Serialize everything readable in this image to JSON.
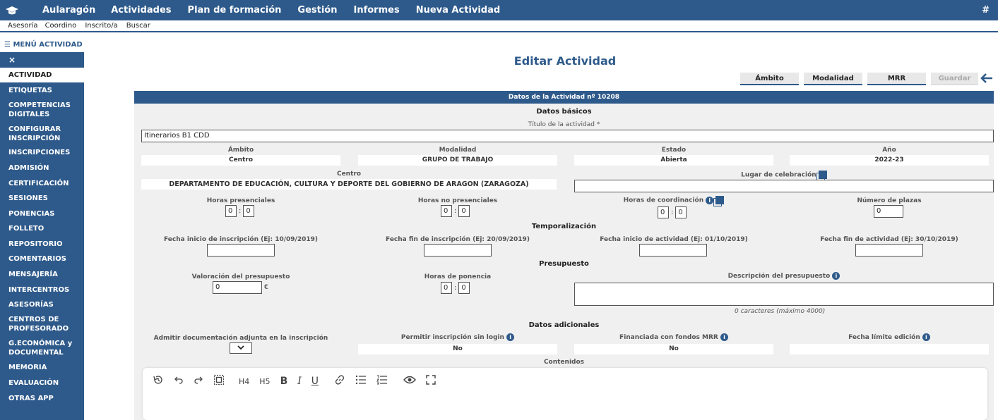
{
  "nav": {
    "brand": "Aularagón",
    "items": [
      "Actividades",
      "Plan de formación",
      "Gestión",
      "Informes",
      "Nueva Actividad"
    ],
    "hash": "#"
  },
  "submenu": [
    "Asesoría",
    "Coordino",
    "Inscrito/a",
    "Buscar"
  ],
  "sidebar": {
    "title": "☰ MENÚ ACTIVIDAD",
    "close": "×",
    "items": [
      "ACTIVIDAD",
      "ETIQUETAS",
      "COMPETENCIAS DIGITALES",
      "CONFIGURAR INSCRIPCIÓN",
      "INSCRIPCIONES",
      "ADMISIÓN",
      "CERTIFICACIÓN",
      "SESIONES",
      "PONENCIAS",
      "FOLLETO",
      "REPOSITORIO",
      "COMENTARIOS",
      "MENSAJERÍA",
      "INTERCENTROS",
      "ASESORÍAS",
      "CENTROS DE PROFESORADO",
      "G.ECONÓMICA y DOCUMENTAL",
      "MEMORIA",
      "EVALUACIÓN",
      "OTRAS APP"
    ]
  },
  "page": {
    "title": "Editar Actividad",
    "buttons": [
      "Ámbito",
      "Modalidad",
      "MRR",
      "Guardar"
    ],
    "back": "🡐"
  },
  "form": {
    "header": "Datos de la Actividad nº 10208",
    "sections": {
      "basicos": "Datos básicos",
      "temporalizacion": "Temporalización",
      "presupuesto": "Presupuesto",
      "adicionales": "Datos adicionales",
      "contenidos": "Contenidos"
    },
    "titulo_label": "Título de la actividad *",
    "titulo_value": "Itinerarios B1 CDD",
    "ambito_label": "Ámbito",
    "ambito_value": "Centro",
    "modalidad_label": "Modalidad",
    "modalidad_value": "GRUPO DE TRABAJO",
    "estado_label": "Estado",
    "estado_value": "Abierta",
    "anio_label": "Año",
    "anio_value": "2022-23",
    "centro_label": "Centro",
    "centro_value": "DEPARTAMENTO DE EDUCACIÓN, CULTURA Y DEPORTE DEL GOBIERNO DE ARAGON (ZARAGOZA)",
    "lugar_label": "Lugar de celebración",
    "horas_pres_label": "Horas presenciales",
    "horas_nopres_label": "Horas no presenciales",
    "horas_coord_label": "Horas de coordinación",
    "plazas_label": "Número de plazas",
    "zero": "0",
    "colon": ":",
    "fecha_ini_insc": "Fecha inicio de inscripción (Ej: 10/09/2019)",
    "fecha_fin_insc": "Fecha fin de inscripción (Ej: 20/09/2019)",
    "fecha_ini_act": "Fecha inicio de actividad (Ej: 01/10/2019)",
    "fecha_fin_act": "Fecha fin de actividad (Ej: 30/10/2019)",
    "valoracion_label": "Valoración del presupuesto",
    "euro": "€",
    "horas_ponencia_label": "Horas de ponencia",
    "desc_presupuesto_label": "Descripción del presupuesto",
    "caracteres": "0 caracteres (máximo 4000)",
    "admitir_label": "Admitir documentación adjunta en la inscripción",
    "permitir_label": "Permitir inscripción sin login",
    "permitir_value": "No",
    "financiada_label": "Financiada con fondos MRR",
    "financiada_value": "No",
    "fecha_limite_label": "Fecha límite edición"
  },
  "editor": {
    "toolbar": [
      "history-icon",
      "undo-icon",
      "redo-icon",
      "select-all-icon",
      "H4",
      "H5",
      "B",
      "I",
      "U",
      "link-icon",
      "bullet-list-icon",
      "numbered-list-icon",
      "preview-icon",
      "fullscreen-icon"
    ],
    "h4": "H4",
    "h5": "H5",
    "bold": "B",
    "italic": "I",
    "underline": "U"
  },
  "colors": {
    "primary": "#2e5a8b",
    "panel": "#f0f0f0"
  }
}
